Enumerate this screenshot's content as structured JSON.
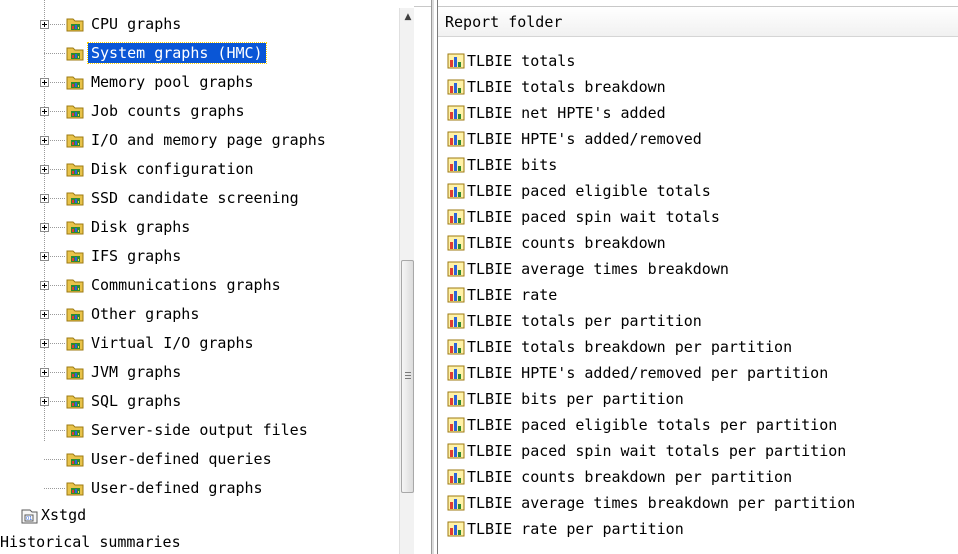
{
  "tree": {
    "items": [
      {
        "label": "CPU graphs",
        "expandable": true
      },
      {
        "label": "System graphs (HMC)",
        "expandable": false,
        "selected": true
      },
      {
        "label": "Memory pool graphs",
        "expandable": true
      },
      {
        "label": "Job counts graphs",
        "expandable": true
      },
      {
        "label": "I/O and memory page graphs",
        "expandable": true
      },
      {
        "label": "Disk configuration",
        "expandable": true
      },
      {
        "label": "SSD candidate screening",
        "expandable": true
      },
      {
        "label": "Disk graphs",
        "expandable": true
      },
      {
        "label": "IFS graphs",
        "expandable": true
      },
      {
        "label": "Communications graphs",
        "expandable": true
      },
      {
        "label": "Other graphs",
        "expandable": true
      },
      {
        "label": "Virtual I/O graphs",
        "expandable": true
      },
      {
        "label": "JVM graphs",
        "expandable": true
      },
      {
        "label": "SQL graphs",
        "expandable": true
      },
      {
        "label": "Server-side output files",
        "expandable": false
      },
      {
        "label": "User-defined queries",
        "expandable": false
      },
      {
        "label": "User-defined graphs",
        "expandable": false
      }
    ],
    "root_item": {
      "label": "Xstgd",
      "icon": "collection-icon"
    },
    "historical": {
      "label": "Historical summaries"
    }
  },
  "report_panel": {
    "header": "Report folder",
    "items": [
      "TLBIE totals",
      "TLBIE totals breakdown",
      "TLBIE net HPTE's added",
      "TLBIE HPTE's added/removed",
      "TLBIE bits",
      "TLBIE paced eligible totals",
      "TLBIE paced spin wait totals",
      "TLBIE counts breakdown",
      "TLBIE average times breakdown",
      "TLBIE rate",
      "TLBIE totals per partition",
      "TLBIE totals breakdown per partition",
      "TLBIE HPTE's added/removed per partition",
      "TLBIE bits per partition",
      "TLBIE paced eligible totals per partition",
      "TLBIE paced spin wait totals per partition",
      "TLBIE counts breakdown per partition",
      "TLBIE average times breakdown per partition",
      "TLBIE rate per partition"
    ]
  },
  "colors": {
    "selection": "#0a56d6",
    "folder": "#e8c34a",
    "folder_tab": "#2f8a2f"
  },
  "icons": {
    "folder": "graph-folder-icon",
    "report": "bar-chart-icon",
    "scroll_up": "▲",
    "grip": "scroll-grip-icon"
  }
}
